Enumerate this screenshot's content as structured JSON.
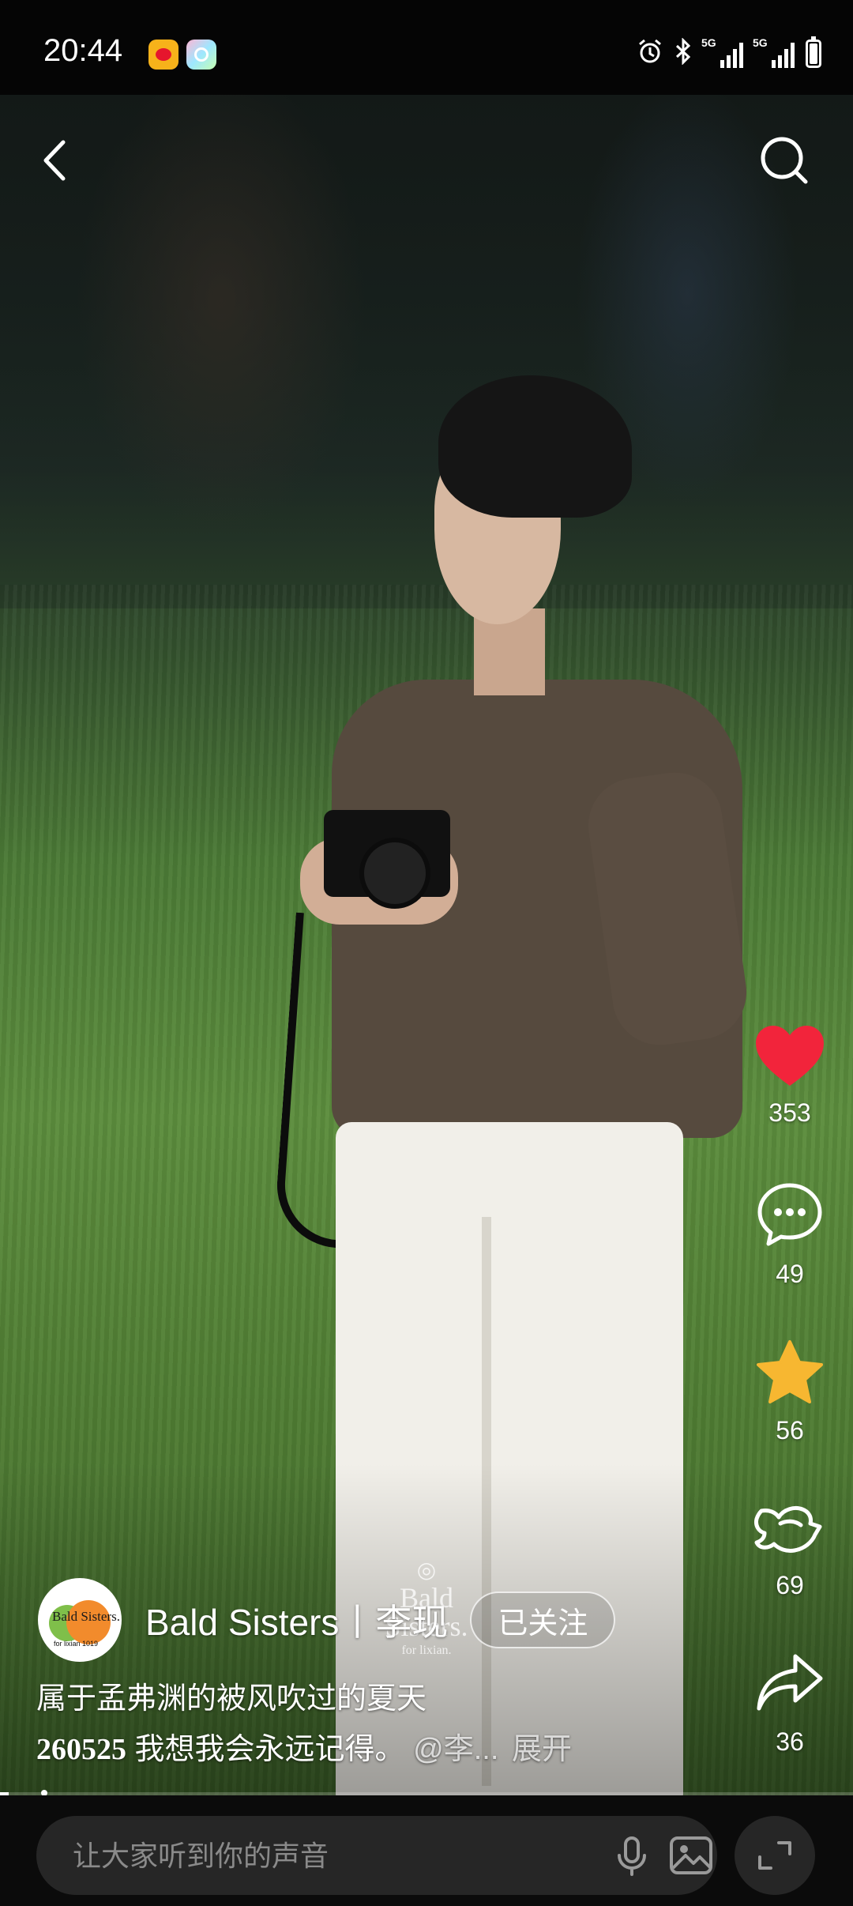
{
  "status_bar": {
    "time": "20:44",
    "network_labels": [
      "5G",
      "5G"
    ],
    "icons": [
      "weibo-app-icon",
      "camera-app-icon",
      "alarm-icon",
      "bluetooth-icon",
      "signal-icon",
      "battery-icon"
    ]
  },
  "nav": {
    "back_icon": "chevron-left-icon",
    "search_icon": "search-icon"
  },
  "actions": {
    "like_count": "353",
    "comment_count": "49",
    "favorite_count": "56",
    "repost_count": "69",
    "share_count": "36"
  },
  "author": {
    "avatar_text": "Bald Sisters.",
    "avatar_subtext": "for lixian 1019",
    "name": "Bald Sisters丨李现",
    "follow_label": "已关注"
  },
  "caption": {
    "line1": "属于孟弗渊的被风吹过的夏天",
    "line2_date": "260525",
    "line2_text": " 我想我会永远记得。",
    "mention": "@李...",
    "expand": "展开"
  },
  "watermark": {
    "line1": "Bald",
    "line2": "Sisters.",
    "line3": "for lixian."
  },
  "progress": 0.01,
  "comment_bar": {
    "placeholder": "让大家听到你的声音"
  },
  "colors": {
    "like": "#f2243b",
    "favorite": "#f7b731"
  }
}
